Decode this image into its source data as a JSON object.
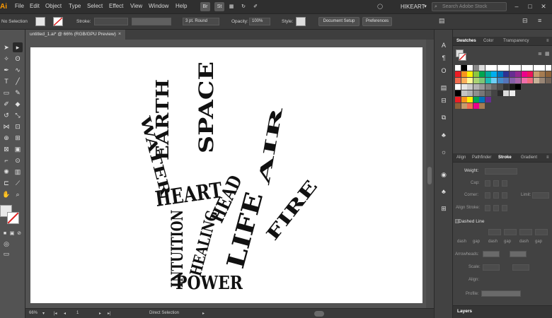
{
  "app": {
    "logo": "Ai"
  },
  "menu": [
    "File",
    "Edit",
    "Object",
    "Type",
    "Select",
    "Effect",
    "View",
    "Window",
    "Help"
  ],
  "menubar_icons": [
    "Br",
    "St"
  ],
  "workspace": "HIKEART",
  "search": {
    "placeholder": "Search Adobe Stock"
  },
  "control": {
    "selection": "No Selection",
    "stroke_label": "Stroke:",
    "brush_value": "3 pt. Round",
    "opacity_label": "Opacity:",
    "opacity_value": "100%",
    "style_label": "Style:",
    "document_setup": "Document Setup",
    "preferences": "Preferences"
  },
  "document": {
    "tab_title": "untitled_1.ai* @ 66% (RGB/GPU Preview)",
    "close": "×"
  },
  "artwork_words": [
    "WATER",
    "EARTH",
    "SPACE",
    "AIR",
    "HEART",
    "HEAD",
    "LIFE",
    "FIRE",
    "INTUITION",
    "HEALING",
    "POWER"
  ],
  "status": {
    "zoom": "66%",
    "artboard_number": "1",
    "tool_name": "Direct Selection"
  },
  "panels": {
    "swatch_tabs": [
      "Swatches",
      "Color",
      "Transparency"
    ],
    "stroke_tabs": [
      "Align",
      "Pathfinder",
      "Stroke",
      "Gradient"
    ],
    "weight_label": "Weight:",
    "cap_label": "Cap:",
    "corner_label": "Corner:",
    "limit_label": "Limit:",
    "align_stroke_label": "Align Stroke:",
    "dashed_line": "Dashed Line",
    "dash_labels": [
      "dash",
      "gap",
      "dash",
      "gap",
      "dash",
      "gap"
    ],
    "arrowheads_label": "Arrowheads:",
    "scale_label": "Scale:",
    "align_label": "Align:",
    "profile_label": "Profile:",
    "layers_tab": "Layers"
  },
  "colors": {
    "accent": "#ff9a00",
    "swatch_rows": [
      [
        "#ffffff",
        "#000000",
        "#ffffff",
        "#888888",
        "#dddddd",
        "#ffffff",
        "#ffffff",
        "#ffffff",
        "#ffffff",
        "#ffffff",
        "#ffffff",
        "#ffffff",
        "#ffffff",
        "#ffffff",
        "#ffffff",
        "#ffffff"
      ],
      [
        "#ed1c24",
        "#f7941d",
        "#fff200",
        "#8dc63f",
        "#00a651",
        "#00a99d",
        "#00aeef",
        "#0072bc",
        "#2e3192",
        "#662d91",
        "#92278f",
        "#ec008c",
        "#ed145b",
        "#c69c6d",
        "#a67c52",
        "#8c6239"
      ],
      [
        "#f26c4f",
        "#fbaf5d",
        "#fff799",
        "#acd373",
        "#7cc576",
        "#1cbbb4",
        "#6dcff6",
        "#448ccb",
        "#5674b9",
        "#8560a8",
        "#a763a8",
        "#f06eaa",
        "#f26d7d",
        "#c7b299",
        "#998675",
        "#736357"
      ],
      [
        "#ffffff",
        "#e6e6e6",
        "#cccccc",
        "#b3b3b3",
        "#999999",
        "#808080",
        "#666666",
        "#4d4d4d",
        "#333333",
        "#1a1a1a",
        "#000000"
      ],
      [
        "#000000",
        "#c4c4c4",
        "#b0b0b0",
        "#8f8f8f",
        "#777777",
        "#5e5e5e",
        "#444444",
        "#2b2b2b",
        "#dcdcdc",
        "#eeeeee"
      ],
      [
        "#ed1c24",
        "#f7941d",
        "#fff200",
        "#00a651",
        "#0072bc",
        "#662d91"
      ],
      [
        "#8c6239",
        "#c69c6d",
        "#f26c4f",
        "#ec008c",
        "#a67c52"
      ]
    ]
  }
}
